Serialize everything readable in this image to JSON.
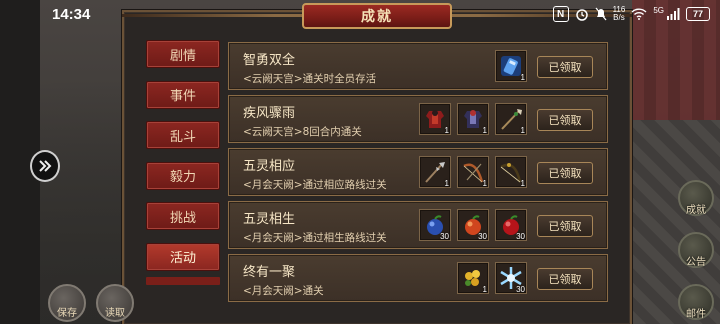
{
  "status_bar": {
    "time": "14:34",
    "nfc_label": "N",
    "speed_value": "116",
    "speed_unit": "B/s",
    "network_label": "5G",
    "battery": "77"
  },
  "dialog": {
    "title": "成就",
    "tabs": [
      {
        "label": "剧情",
        "active": false
      },
      {
        "label": "事件",
        "active": false
      },
      {
        "label": "乱斗",
        "active": false
      },
      {
        "label": "毅力",
        "active": false
      },
      {
        "label": "挑战",
        "active": false
      },
      {
        "label": "活动",
        "active": true
      }
    ],
    "achievements": [
      {
        "title": "智勇双全",
        "desc": "<云阙天宫>通关时全员存活",
        "button": "已领取",
        "rewards": [
          {
            "icon": "blue-scroll-icon",
            "count": "1"
          }
        ]
      },
      {
        "title": "疾风骤雨",
        "desc": "<云阙天宫>8回合内通关",
        "button": "已领取",
        "rewards": [
          {
            "icon": "red-armor-icon",
            "count": "1"
          },
          {
            "icon": "dark-armor-icon",
            "count": "1"
          },
          {
            "icon": "spear-icon",
            "count": "1"
          }
        ]
      },
      {
        "title": "五灵相应",
        "desc": "<月会天阙>通过相应路线过关",
        "button": "已领取",
        "rewards": [
          {
            "icon": "halberd-icon",
            "count": "1"
          },
          {
            "icon": "bow-icon",
            "count": "1"
          },
          {
            "icon": "long-bow-icon",
            "count": "1"
          }
        ]
      },
      {
        "title": "五灵相生",
        "desc": "<月会天阙>通过相生路线过关",
        "button": "已领取",
        "rewards": [
          {
            "icon": "blue-fruit-icon",
            "count": "30"
          },
          {
            "icon": "orange-fruit-icon",
            "count": "30"
          },
          {
            "icon": "red-fruit-icon",
            "count": "30"
          }
        ]
      },
      {
        "title": "终有一聚",
        "desc": "<月会天阙>通关",
        "button": "已领取",
        "rewards": [
          {
            "icon": "gold-flower-icon",
            "count": "1"
          },
          {
            "icon": "ice-crystal-icon",
            "count": "30"
          }
        ]
      }
    ]
  },
  "side_buttons": {
    "save": "保存",
    "load": "读取",
    "achievements": "成就",
    "notice": "公告",
    "mail": "邮件"
  },
  "colors": {
    "accent_red": "#8c2721",
    "gold_border": "#8a6b46",
    "panel_bg": "#3c3027"
  }
}
